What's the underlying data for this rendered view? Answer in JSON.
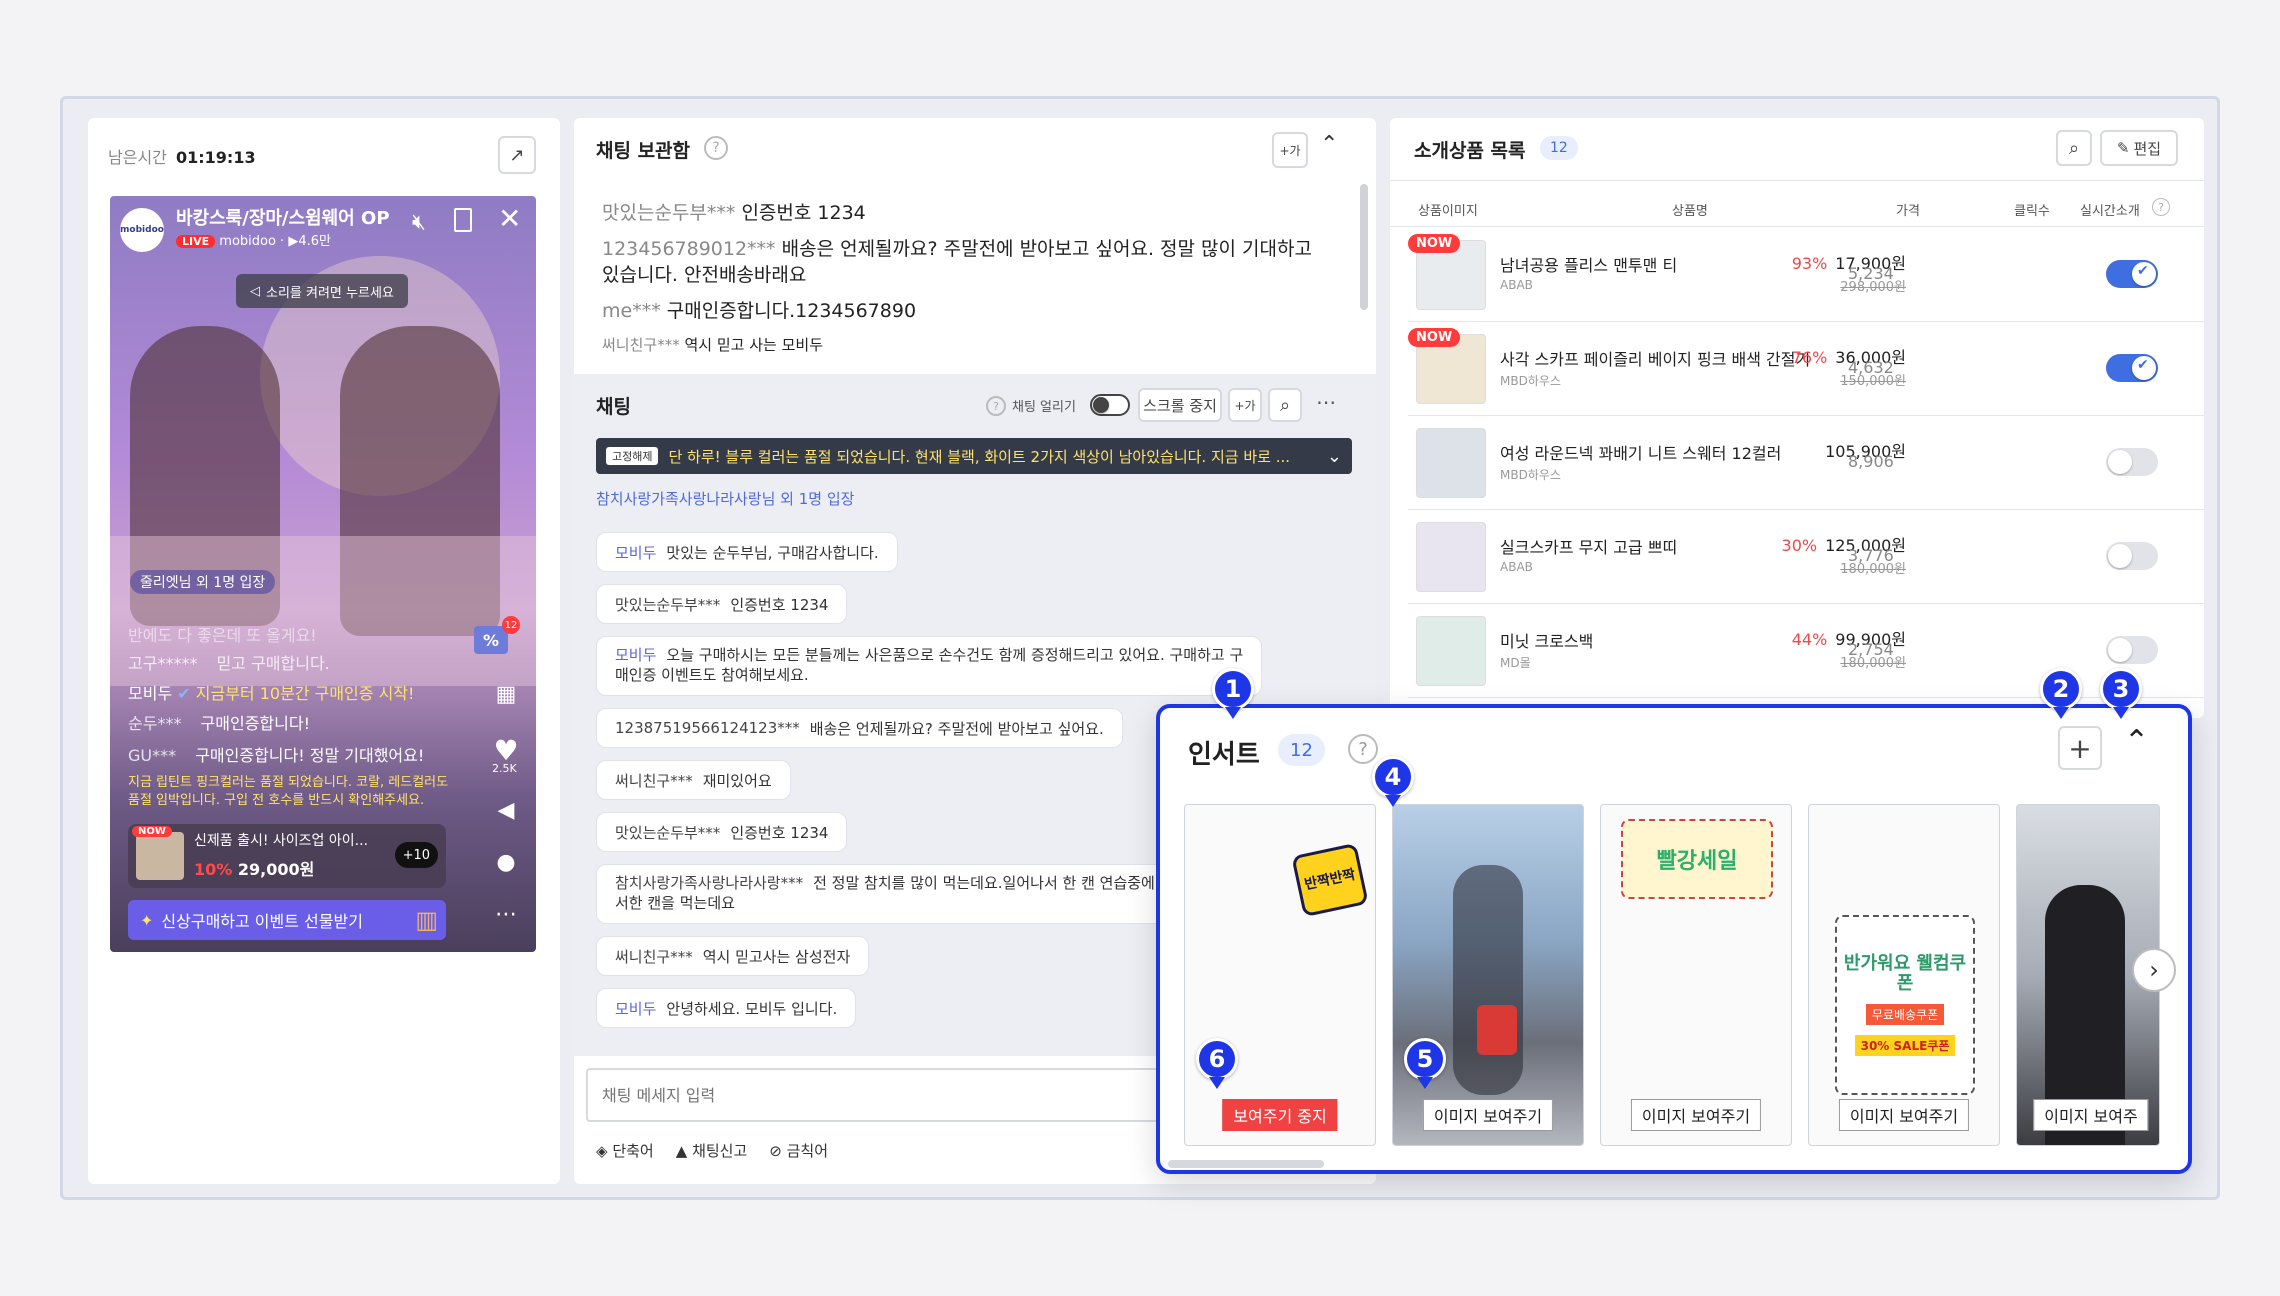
{
  "left": {
    "remain_label": "남은시간",
    "remain_time": "01:19:13",
    "video": {
      "channel_logo": "mobidoo",
      "title": "바캉스룩/장마/스윔웨어 OP",
      "live_badge": "LIVE",
      "channel": "mobidoo · ▶4.6만",
      "sound_hint": "소리를 켜려면 누르세요",
      "enter_notice": "줄리엣님 외 1명 입장",
      "chats": [
        {
          "user": "반에도",
          "text": "다 좋은데 또 올게요!"
        },
        {
          "user": "고구*****",
          "text": "믿고 구매합니다."
        },
        {
          "user": "모비두",
          "text": "지금부터 10분간 구매인증 시작!"
        },
        {
          "user": "순두***",
          "text": "구매인증합니다!"
        },
        {
          "user": "GU***",
          "text": "구매인증합니다! 정말 기대했어요!"
        }
      ],
      "notice": "지금 립틴트 핑크컬러는 품절 되었습니다. 코랄, 레드컬러도 품절 임박입니다. 구입 전 호수를 반드시 확인해주세요.",
      "product_now": "NOW",
      "product_name": "신제품 출시! 사이즈업 아이...",
      "product_discount": "10%",
      "product_price": "29,000원",
      "product_more": "+10",
      "coupon_button": "신상구매하고 이벤트 선물받기",
      "coupon_badge": "12",
      "like_count": "2.5K"
    }
  },
  "mid": {
    "archive_title": "채팅 보관함",
    "font_button": "+가",
    "archive_messages": [
      {
        "user": "맛있는순두부***",
        "text": "인증번호 1234"
      },
      {
        "user": "123456789012***",
        "text": "배송은 언제될까요? 주말전에 받아보고 싶어요. 정말 많이 기대하고 있습니다. 안전배송바래요"
      },
      {
        "user": "me***",
        "text": "구매인증합니다.1234567890"
      },
      {
        "user": "써니친구***",
        "text": "역시 믿고 사는 모비두"
      }
    ],
    "chat_title": "채팅",
    "chat_freeze_label": "채팅 얼리기",
    "scroll_stop": "스크롤 중지",
    "pinned_tag": "고정해제",
    "pinned_text": "단 하루! 블루 컬러는 품절 되었습니다. 현재 블랙, 화이트 2가지 색상이 남아있습니다. 지금 바로 ...",
    "enter_notice": "참치사랑가족사랑나라사랑님 외 1명 입장",
    "messages": [
      {
        "user": "모비두",
        "text": "맛있는 순두부님, 구매감사합니다.",
        "admin": true
      },
      {
        "user": "맛있는순두부***",
        "text": "인증번호 1234",
        "admin": false
      },
      {
        "user": "모비두",
        "text": "오늘 구매하시는 모든 분들께는 사은품으로 손수건도 함께 증정해드리고 있어요. 구매하고 구",
        "text2": "매인증 이벤트도 참여해보세요.",
        "admin": true
      },
      {
        "user": "12387519566124123***",
        "text": "배송은 언제될까요? 주말전에 받아보고 싶어요.",
        "admin": false
      },
      {
        "user": "써니친구***",
        "text": "재미있어요",
        "admin": false
      },
      {
        "user": "맛있는순두부***",
        "text": "인증번호 1234",
        "admin": false
      },
      {
        "user": "참치사랑가족사랑나라사랑***",
        "text": "전 정말 참치를 많이 먹는데요.일어나서 한 캔 연습중에",
        "text2": "서한 캔을 먹는데요",
        "admin": false
      },
      {
        "user": "써니친구***",
        "text": "역시 믿고사는 삼성전자",
        "admin": false
      },
      {
        "user": "모비두",
        "text": "안녕하세요. 모비두 입니다.",
        "admin": true
      }
    ],
    "input_placeholder": "채팅 메세지 입력",
    "footer": [
      "단축어",
      "채팅신고",
      "금칙어"
    ]
  },
  "right": {
    "title": "소개상품 목록",
    "count": "12",
    "edit_button": "편집",
    "columns": [
      "상품이미지",
      "상품명",
      "가격",
      "클릭수",
      "실시간소개"
    ],
    "products": [
      {
        "now": "NOW",
        "name": "남녀공용 플리스 맨투맨 티",
        "brand": "ABAB",
        "discount": "93%",
        "price": "17,900원",
        "orig": "298,000원",
        "clicks": "5,234",
        "live": true
      },
      {
        "now": "NOW",
        "name": "사각 스카프 페이즐리 베이지 핑크 배색 간절기",
        "brand": "MBD하우스",
        "discount": "76%",
        "price": "36,000원",
        "orig": "150,000원",
        "clicks": "4,632",
        "live": true
      },
      {
        "now": "",
        "name": "여성 라운드넥 꽈배기 니트 스웨터 12컬러",
        "brand": "MBD하우스",
        "discount": "",
        "price": "105,900원",
        "orig": "",
        "clicks": "8,906",
        "live": false
      },
      {
        "now": "",
        "name": "실크스카프 무지 고급 쁘띠",
        "brand": "ABAB",
        "discount": "30%",
        "price": "125,000원",
        "orig": "180,000원",
        "clicks": "3,776",
        "live": false
      },
      {
        "now": "",
        "name": "미닛 크로스백",
        "brand": "MD몰",
        "discount": "44%",
        "price": "99,900원",
        "orig": "180,000원",
        "clicks": "2,754",
        "live": false
      }
    ]
  },
  "insert": {
    "title": "인서트",
    "count": "12",
    "cards": [
      {
        "art": "반짝반짝",
        "button": "보여주기 중지",
        "active": true
      },
      {
        "art": "",
        "button": "이미지 보여주기",
        "active": false
      },
      {
        "art": "빨강세일",
        "button": "이미지 보여주기",
        "active": false
      },
      {
        "art": "반가워요 웰컴쿠폰",
        "art2": "무료배송쿠폰",
        "art3": "30% SALE쿠폰",
        "button": "이미지 보여주기",
        "active": false
      },
      {
        "art": "",
        "button": "이미지 보여주",
        "active": false
      }
    ],
    "markers": [
      "1",
      "2",
      "3",
      "4",
      "5",
      "6"
    ]
  },
  "colors": {
    "accent": "#1f36e6",
    "toggle_on": "#3f6ee0",
    "sale": "#f04848",
    "admin_name": "#5b67d8"
  }
}
